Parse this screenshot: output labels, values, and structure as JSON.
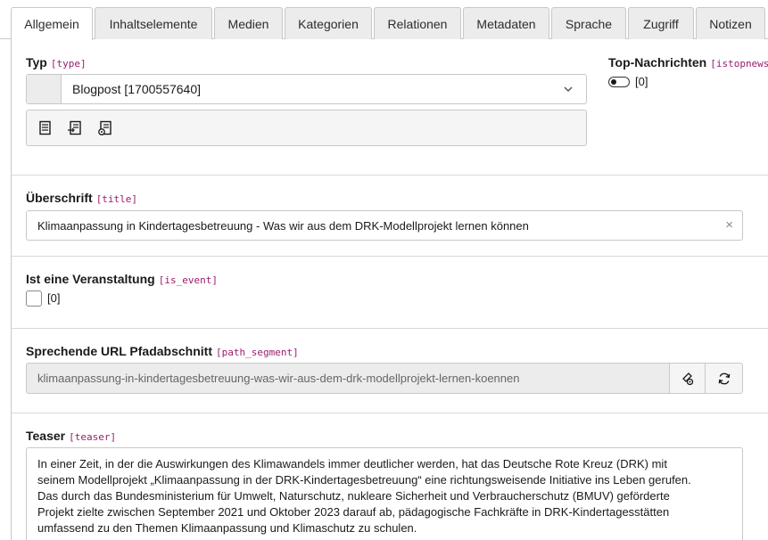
{
  "tabs": [
    {
      "label": "Allgemein",
      "active": true
    },
    {
      "label": "Inhaltselemente"
    },
    {
      "label": "Medien"
    },
    {
      "label": "Kategorien"
    },
    {
      "label": "Relationen"
    },
    {
      "label": "Metadaten"
    },
    {
      "label": "Sprache"
    },
    {
      "label": "Zugriff"
    },
    {
      "label": "Notizen"
    }
  ],
  "type_field": {
    "label": "Typ",
    "code": "[type]",
    "value": "Blogpost [1700557640]",
    "wizard_icons": [
      "record-list-icon",
      "record-insert-icon",
      "record-edit-icon"
    ]
  },
  "top_news": {
    "label": "Top-Nachrichten",
    "code": "[istopnews]",
    "value": "[0]",
    "checked": false
  },
  "title_field": {
    "label": "Überschrift",
    "code": "[title]",
    "value": "Klimaanpassung in Kindertagesbetreuung - Was wir aus dem DRK-Modellprojekt lernen können",
    "clear_symbol": "×"
  },
  "is_event": {
    "label": "Ist eine Veranstaltung",
    "code": "[is_event]",
    "value": "[0]",
    "checked": false
  },
  "path_segment": {
    "label": "Sprechende URL Pfadabschnitt",
    "code": "[path_segment]",
    "value": "klimaanpassung-in-kindertagesbetreuung-was-wir-aus-dem-drk-modellprojekt-lernen-koennen"
  },
  "teaser": {
    "label": "Teaser",
    "code": "[teaser]",
    "lines": [
      "In einer Zeit, in der die Auswirkungen des Klimawandels immer deutlicher werden, hat das Deutsche Rote Kreuz (DRK) mit",
      "seinem Modellprojekt „Klimaanpassung in der DRK-Kindertagesbetreuung“ eine richtungsweisende Initiative ins Leben gerufen.",
      "Das durch das Bundesministerium für Umwelt, Naturschutz, nukleare Sicherheit und Verbraucherschutz (BMUV) geförderte",
      "Projekt zielte zwischen September 2021 und Oktober 2023 darauf ab, pädagogische Fachkräfte in DRK-Kindertagesstätten",
      "umfassend zu den Themen Klimaanpassung und Klimaschutz zu schulen."
    ]
  },
  "colors": {
    "code_magenta": "#9b1b6d",
    "border": "#c8c8c8",
    "tab_bg": "#ececec"
  }
}
